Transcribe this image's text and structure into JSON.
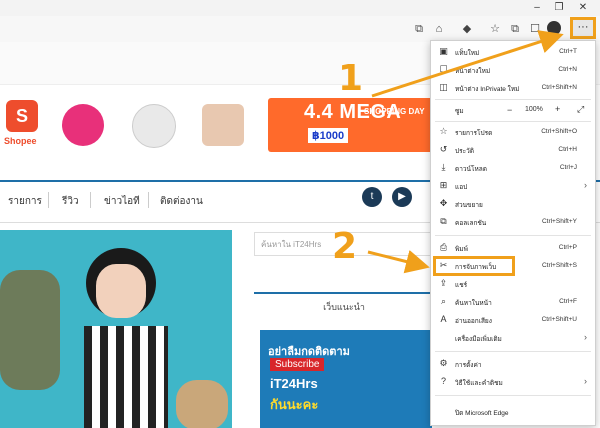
{
  "colors": {
    "accent_orange": "#f0a01b",
    "banner_orange": "#ff6a2b",
    "nav_blue": "#1e6fa8"
  },
  "window": {
    "minimize": "–",
    "restore": "❐",
    "close": "✕"
  },
  "toolbar": {
    "more_label": "···"
  },
  "ad": {
    "shopee_label": "Shopee",
    "mega_title": "4.4 MEGA",
    "mega_sub": "SHOPPING DAY",
    "mega_price": "฿1000"
  },
  "nav": {
    "items": [
      "รายการ",
      "รีวิว",
      "ข่าวไอที",
      "ติดต่องาน"
    ]
  },
  "sidebar": {
    "search_placeholder": "ค้นหาใน iT24Hrs",
    "recommend_label": "เว็บแนะนำ",
    "card": {
      "line1": "อย่าลืมกดติดตาม",
      "line2": "Subscribe",
      "line3": "iT24Hrs",
      "line4": "กันนะคะ"
    }
  },
  "menu": {
    "items": [
      {
        "icon": "new-tab-icon",
        "glyph": "▣",
        "label": "แท็บใหม่",
        "shortcut": "Ctrl+T"
      },
      {
        "icon": "new-window-icon",
        "glyph": "☐",
        "label": "หน้าต่างใหม่",
        "shortcut": "Ctrl+N"
      },
      {
        "icon": "inprivate-icon",
        "glyph": "◫",
        "label": "หน้าต่าง InPrivate ใหม่",
        "shortcut": "Ctrl+Shift+N"
      },
      {
        "icon": "favorites-icon",
        "glyph": "☆",
        "label": "รายการโปรด",
        "shortcut": "Ctrl+Shift+O"
      },
      {
        "icon": "history-icon",
        "glyph": "↺",
        "label": "ประวัติ",
        "shortcut": "Ctrl+H"
      },
      {
        "icon": "downloads-icon",
        "glyph": "⤓",
        "label": "ดาวน์โหลด",
        "shortcut": "Ctrl+J"
      },
      {
        "icon": "apps-icon",
        "glyph": "⊞",
        "label": "แอป",
        "shortcut": ""
      },
      {
        "icon": "extensions-icon",
        "glyph": "✥",
        "label": "ส่วนขยาย",
        "shortcut": ""
      },
      {
        "icon": "collections-icon",
        "glyph": "⧉",
        "label": "คอลเลกชัน",
        "shortcut": "Ctrl+Shift+Y"
      },
      {
        "icon": "print-icon",
        "glyph": "⎙",
        "label": "พิมพ์",
        "shortcut": "Ctrl+P"
      },
      {
        "icon": "web-capture-icon",
        "glyph": "✂",
        "label": "การจับภาพเว็บ",
        "shortcut": "Ctrl+Shift+S"
      },
      {
        "icon": "share-icon",
        "glyph": "⇪",
        "label": "แชร์",
        "shortcut": ""
      },
      {
        "icon": "find-icon",
        "glyph": "⌕",
        "label": "ค้นหาในหน้า",
        "shortcut": "Ctrl+F"
      },
      {
        "icon": "read-aloud-icon",
        "glyph": "A",
        "label": "อ่านออกเสียง",
        "shortcut": "Ctrl+Shift+U"
      },
      {
        "icon": "more-tools-icon",
        "glyph": "",
        "label": "เครื่องมือเพิ่มเติม",
        "shortcut": ""
      },
      {
        "icon": "settings-icon",
        "glyph": "⚙",
        "label": "การตั้งค่า",
        "shortcut": ""
      },
      {
        "icon": "help-icon",
        "glyph": "?",
        "label": "วิธีใช้และคำติชม",
        "shortcut": ""
      },
      {
        "icon": "close-edge-icon",
        "glyph": "",
        "label": "ปิด Microsoft Edge",
        "shortcut": ""
      }
    ],
    "zoom": {
      "label": "ซูม",
      "minus": "−",
      "value": "100%",
      "plus": "+",
      "fullscreen": "⤢"
    }
  },
  "annotations": {
    "step1": "1",
    "step2": "2"
  }
}
